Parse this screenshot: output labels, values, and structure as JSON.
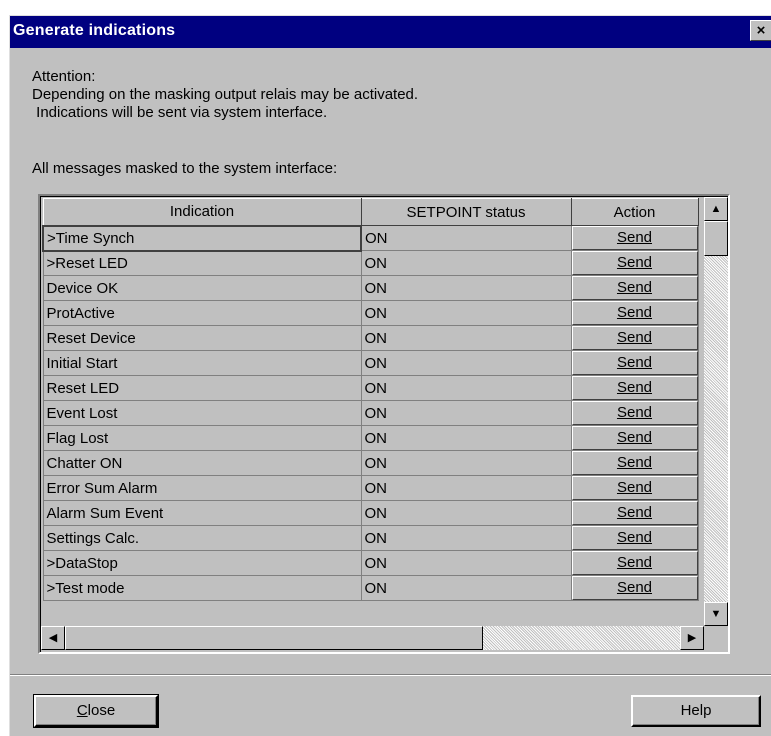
{
  "window": {
    "title": "Generate indications",
    "close_glyph": "×"
  },
  "message": {
    "line1": "Attention:",
    "line2": "Depending on the masking output relais may be activated.",
    "line3": " Indications will be sent via system interface.",
    "line4": "All messages masked to the system interface:"
  },
  "table": {
    "columns": [
      "Indication",
      "SETPOINT status",
      "Action"
    ],
    "rows": [
      {
        "indication": ">Time Synch",
        "status": "ON",
        "action": "Send"
      },
      {
        "indication": ">Reset LED",
        "status": "ON",
        "action": "Send"
      },
      {
        "indication": "Device OK",
        "status": "ON",
        "action": "Send"
      },
      {
        "indication": "ProtActive",
        "status": "ON",
        "action": "Send"
      },
      {
        "indication": "Reset Device",
        "status": "ON",
        "action": "Send"
      },
      {
        "indication": "Initial Start",
        "status": "ON",
        "action": "Send"
      },
      {
        "indication": "Reset LED",
        "status": "ON",
        "action": "Send"
      },
      {
        "indication": "Event Lost",
        "status": "ON",
        "action": "Send"
      },
      {
        "indication": "Flag Lost",
        "status": "ON",
        "action": "Send"
      },
      {
        "indication": "Chatter ON",
        "status": "ON",
        "action": "Send"
      },
      {
        "indication": "Error Sum Alarm",
        "status": "ON",
        "action": "Send"
      },
      {
        "indication": "Alarm Sum Event",
        "status": "ON",
        "action": "Send"
      },
      {
        "indication": "Settings Calc.",
        "status": "ON",
        "action": "Send"
      },
      {
        "indication": ">DataStop",
        "status": "ON",
        "action": "Send"
      },
      {
        "indication": ">Test mode",
        "status": "ON",
        "action": "Send"
      }
    ]
  },
  "buttons": {
    "close": "Close",
    "help": "Help"
  },
  "icons": {
    "scroll_up": "▲",
    "scroll_down": "▼",
    "scroll_left": "◀",
    "scroll_right": "▶"
  },
  "colors": {
    "titlebar": "#000080",
    "face": "#c0c0c0"
  }
}
